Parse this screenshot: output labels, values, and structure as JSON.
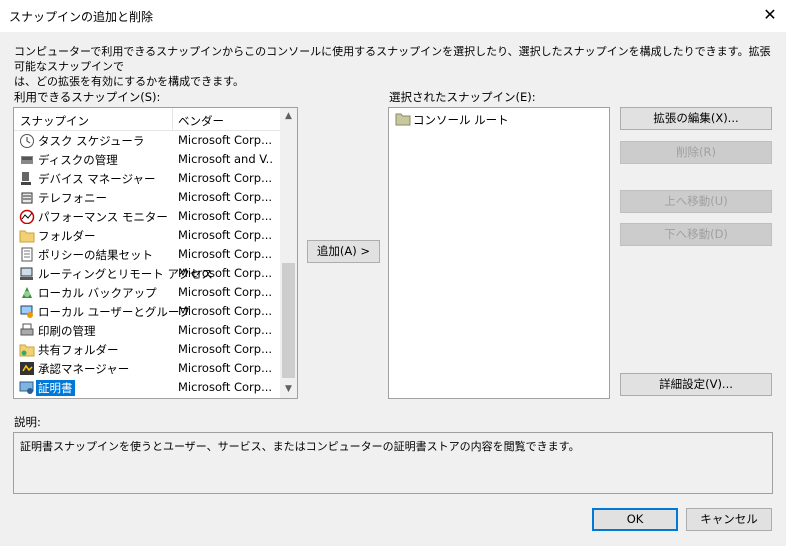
{
  "window": {
    "title": "スナップインの追加と削除",
    "close_label": "✕"
  },
  "intro": "コンピューターで利用できるスナップインからこのコンソールに使用するスナップインを選択したり、選択したスナップインを構成したりできます。拡張可能なスナップインで\nは、どの拡張を有効にするかを構成できます。",
  "available": {
    "label": "利用できるスナップイン(S):",
    "col_snapin": "スナップイン",
    "col_vendor": "ベンダー",
    "items": [
      {
        "name": "タスク スケジューラ",
        "vendor": "Microsoft Corp...",
        "icon": "clock-icon"
      },
      {
        "name": "ディスクの管理",
        "vendor": "Microsoft and V...",
        "icon": "disk-management-icon"
      },
      {
        "name": "デバイス マネージャー",
        "vendor": "Microsoft Corp...",
        "icon": "device-manager-icon"
      },
      {
        "name": "テレフォニー",
        "vendor": "Microsoft Corp...",
        "icon": "telephony-icon"
      },
      {
        "name": "パフォーマンス モニター",
        "vendor": "Microsoft Corp...",
        "icon": "performance-monitor-icon"
      },
      {
        "name": "フォルダー",
        "vendor": "Microsoft Corp...",
        "icon": "folder-icon"
      },
      {
        "name": "ポリシーの結果セット",
        "vendor": "Microsoft Corp...",
        "icon": "policy-document-icon"
      },
      {
        "name": "ルーティングとリモート アクセス",
        "vendor": "Microsoft Corp...",
        "icon": "routing-icon"
      },
      {
        "name": "ローカル バックアップ",
        "vendor": "Microsoft Corp...",
        "icon": "backup-icon"
      },
      {
        "name": "ローカル ユーザーとグループ",
        "vendor": "Microsoft Corp...",
        "icon": "users-groups-icon"
      },
      {
        "name": "印刷の管理",
        "vendor": "Microsoft Corp...",
        "icon": "printer-icon"
      },
      {
        "name": "共有フォルダー",
        "vendor": "Microsoft Corp...",
        "icon": "shared-folder-icon"
      },
      {
        "name": "承認マネージャー",
        "vendor": "Microsoft Corp...",
        "icon": "authorization-manager-icon"
      },
      {
        "name": "証明書",
        "vendor": "Microsoft Corp...",
        "icon": "certificate-icon",
        "selected": true
      }
    ]
  },
  "add_button": "追加(A) >",
  "selected": {
    "label": "選択されたスナップイン(E):",
    "items": [
      {
        "name": "コンソール ルート",
        "icon": "console-root-folder-icon"
      }
    ]
  },
  "buttons": {
    "edit_extensions": "拡張の編集(X)...",
    "remove": "削除(R)",
    "move_up": "上へ移動(U)",
    "move_down": "下へ移動(D)",
    "advanced": "詳細設定(V)...",
    "ok": "OK",
    "cancel": "キャンセル"
  },
  "description": {
    "label": "説明:",
    "text": "証明書スナップインを使うとユーザー、サービス、またはコンピューターの証明書ストアの内容を閲覧できます。"
  }
}
